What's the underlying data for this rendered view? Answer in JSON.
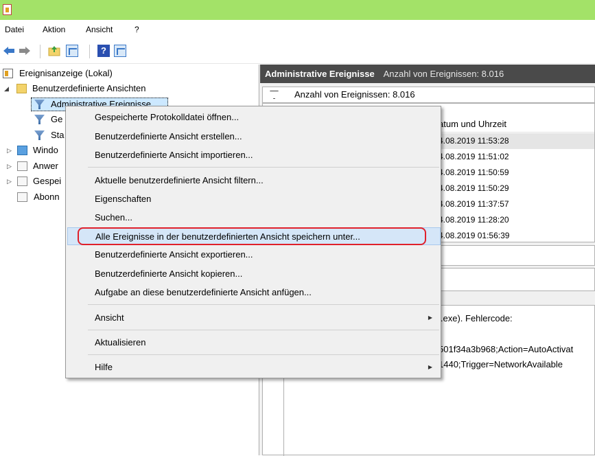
{
  "menubar": {
    "items": [
      "Datei",
      "Aktion",
      "Ansicht",
      "?"
    ]
  },
  "tree": {
    "root": "Ereignisanzeige (Lokal)",
    "custom_views": "Benutzerdefinierte Ansichten",
    "admin_events": "Administrative Ereignisse",
    "item_ge": "Ge",
    "item_sta": "Sta",
    "windows_logs": "Windo",
    "app_logs": "Anwer",
    "saved_logs": "Gespei",
    "subscriptions": "Abonn"
  },
  "right": {
    "header_title": "Administrative Ereignisse",
    "header_count": "Anzahl von Ereignissen: 8.016",
    "filter_text": "Anzahl von Ereignissen: 8.016",
    "col_datetime": "atum und Uhrzeit",
    "rows": [
      "4.08.2019 11:53:28",
      "4.08.2019 11:51:02",
      "4.08.2019 11:50:59",
      "4.08.2019 11:50:29",
      "4.08.2019 11:37:57",
      "4.08.2019 11:28:20",
      "4.08.2019 01:56:39"
    ],
    "detail_line1": "i.exe). Fehlercode:",
    "detail_line2": "501f34a3b968;Action=AutoActivat",
    "detail_line3": "1440;Trigger=NetworkAvailable"
  },
  "context_menu": {
    "open_saved_log": "Gespeicherte Protokolldatei öffnen...",
    "create_custom_view": "Benutzerdefinierte Ansicht erstellen...",
    "import_custom_view": "Benutzerdefinierte Ansicht importieren...",
    "filter_current_view": "Aktuelle benutzerdefinierte Ansicht filtern...",
    "properties": "Eigenschaften",
    "find": "Suchen...",
    "save_all_events": "Alle Ereignisse in der benutzerdefinierten Ansicht speichern unter...",
    "export_custom_view": "Benutzerdefinierte Ansicht exportieren...",
    "copy_custom_view": "Benutzerdefinierte Ansicht kopieren...",
    "attach_task": "Aufgabe an diese benutzerdefinierte Ansicht anfügen...",
    "view": "Ansicht",
    "refresh": "Aktualisieren",
    "help": "Hilfe"
  },
  "colors": {
    "titlebar": "#a3e268",
    "highlight": "#d5e6f8",
    "annotation": "#e0202a",
    "pane_header": "#4a4a4a"
  },
  "icons": [
    "app-icon",
    "back-arrow-icon",
    "forward-arrow-icon",
    "folder-up-icon",
    "show-hide-tree-icon",
    "help-icon",
    "show-hide-action-icon",
    "filter-icon",
    "submenu-arrow-icon"
  ]
}
